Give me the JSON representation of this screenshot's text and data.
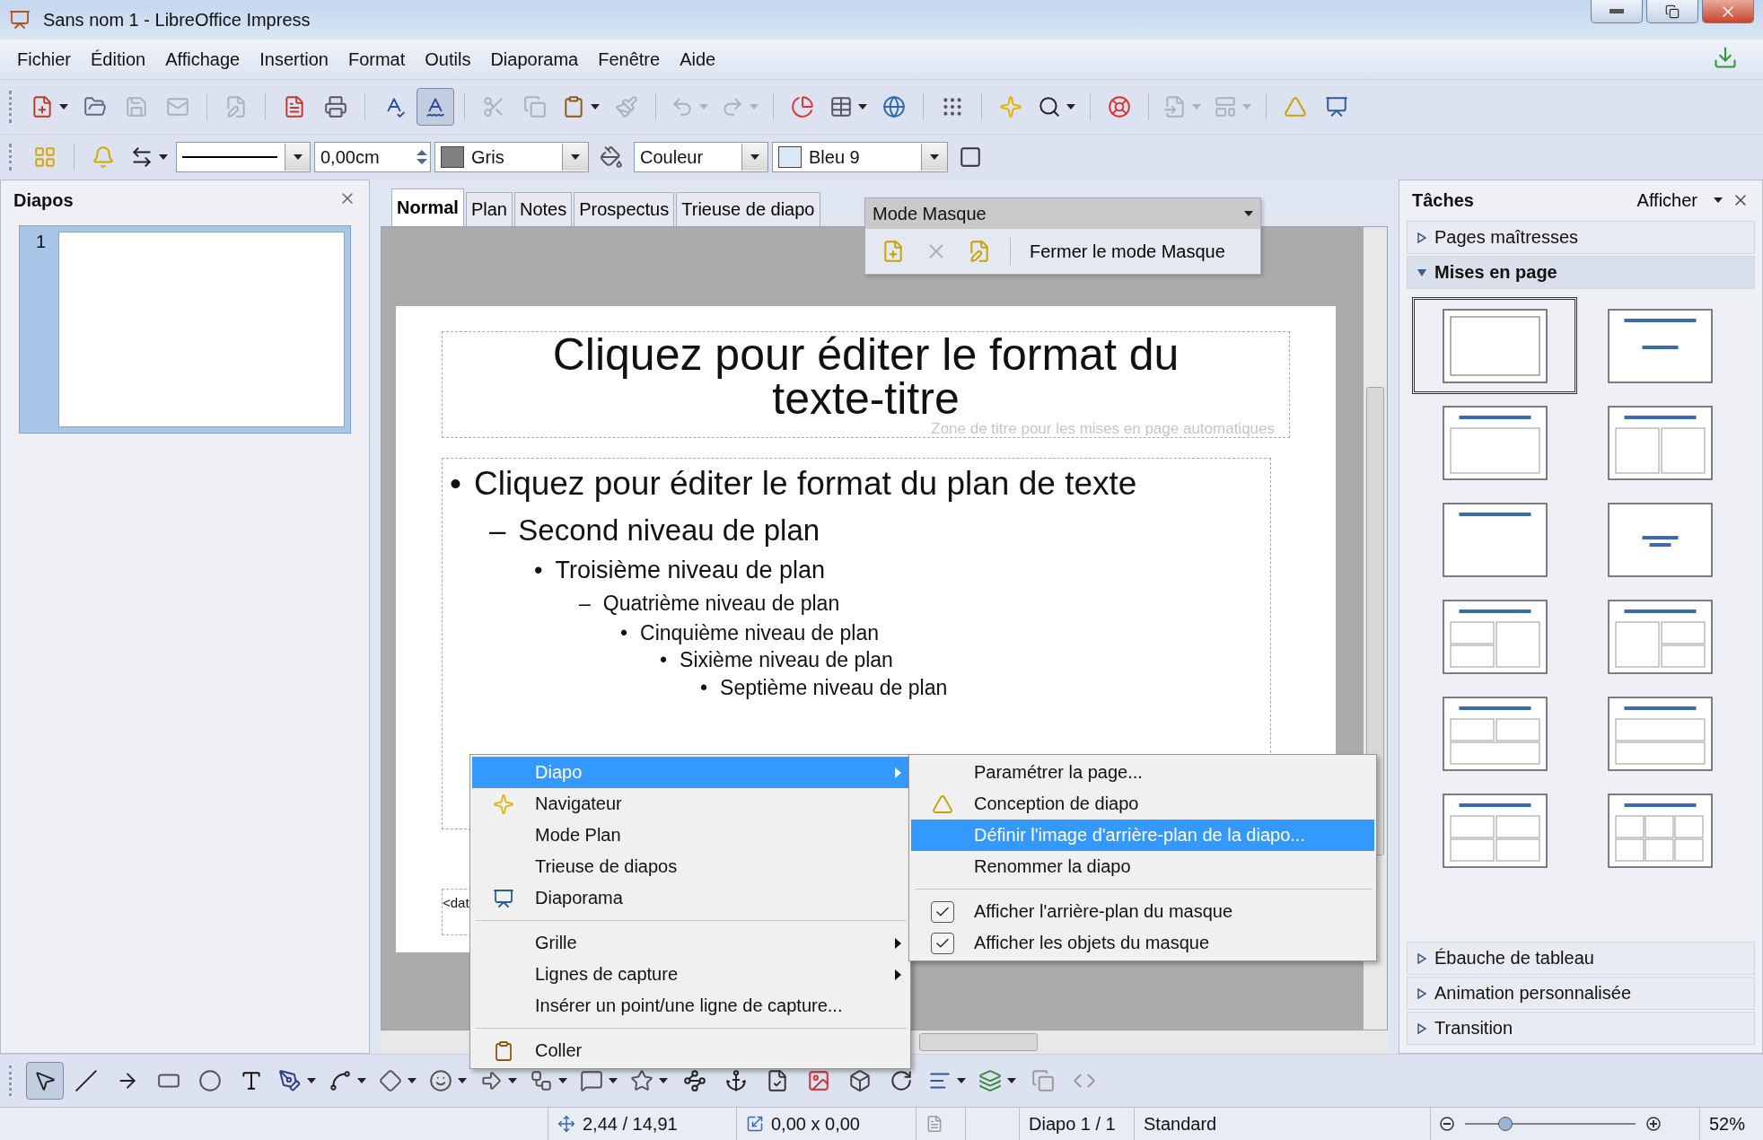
{
  "window": {
    "title": "Sans nom 1 - LibreOffice Impress"
  },
  "menu": [
    "Fichier",
    "Édition",
    "Affichage",
    "Insertion",
    "Format",
    "Outils",
    "Diaporama",
    "Fenêtre",
    "Aide"
  ],
  "toolbar": [
    {
      "disabled": false,
      "pressed": false
    },
    {
      "disabled": false,
      "pressed": false
    },
    {
      "disabled": true,
      "pressed": false
    },
    {
      "disabled": true,
      "pressed": false
    },
    {
      "disabled": true,
      "pressed": false
    },
    {
      "disabled": false,
      "pressed": false
    },
    {
      "disabled": false,
      "pressed": false
    },
    {
      "disabled": false,
      "pressed": false
    },
    {
      "disabled": false,
      "pressed": true
    },
    {
      "disabled": true,
      "pressed": false
    },
    {
      "disabled": true,
      "pressed": false
    },
    {
      "disabled": false,
      "pressed": false
    },
    {
      "disabled": true,
      "pressed": false
    },
    {
      "disabled": true,
      "pressed": false
    },
    {
      "disabled": true,
      "pressed": false
    },
    {
      "disabled": false,
      "pressed": false
    },
    {
      "disabled": false,
      "pressed": false
    },
    {
      "disabled": false,
      "pressed": false
    },
    {
      "disabled": false,
      "pressed": false
    },
    {
      "disabled": false,
      "pressed": false
    },
    {
      "disabled": false,
      "pressed": false
    },
    {
      "disabled": false,
      "pressed": false
    },
    {
      "disabled": true,
      "pressed": false
    },
    {
      "disabled": true,
      "pressed": false
    },
    {
      "disabled": false,
      "pressed": false
    },
    {
      "disabled": false,
      "pressed": false
    }
  ],
  "line_toolbar": {
    "line_width": "0,00cm",
    "line_color": {
      "label": "Gris",
      "color": "#7f7f7f"
    },
    "area_style": "Couleur",
    "area_color": {
      "label": "Bleu 9",
      "color": "#dce9f5"
    }
  },
  "slides_panel": {
    "title": "Diapos",
    "slides": [
      {
        "number": "1",
        "selected": true
      }
    ]
  },
  "tabs": [
    {
      "label": "Normal",
      "selected": true
    },
    {
      "label": "Plan",
      "selected": false
    },
    {
      "label": "Notes",
      "selected": false
    },
    {
      "label": "Prospectus",
      "selected": false
    },
    {
      "label": "Trieuse de diapo",
      "selected": false
    }
  ],
  "master_toolbar": {
    "title": "Mode Masque",
    "close_button": "Fermer le mode Masque"
  },
  "slide": {
    "title": "Cliquez pour éditer le format du texte-titre",
    "title_hint": "Zone de titre pour les mises en page automatiques",
    "footer": "<dat",
    "outline": [
      {
        "marker": "•",
        "text": "Cliquez pour éditer le format du plan de texte",
        "children": [
          {
            "marker": "–",
            "text": "Second niveau de plan",
            "children": [
              {
                "marker": "•",
                "text": "Troisième niveau de plan",
                "children": [
                  {
                    "marker": "–",
                    "text": "Quatrième niveau de plan",
                    "children": [
                      {
                        "marker": "•",
                        "text": "Cinquième niveau de plan",
                        "children": [
                          {
                            "marker": "•",
                            "text": "Sixième niveau de plan",
                            "children": [
                              {
                                "marker": "•",
                                "text": "Septième niveau de plan"
                              }
                            ]
                          }
                        ]
                      }
                    ]
                  }
                ]
              }
            ]
          }
        ]
      }
    ]
  },
  "tasks": {
    "title": "Tâches",
    "view_menu": "Afficher",
    "sections_top": [
      {
        "label": "Pages maîtresses",
        "expanded": false
      },
      {
        "label": "Mises en page",
        "expanded": true
      }
    ],
    "layouts": [
      {
        "kind": "blank",
        "selected": true
      },
      {
        "kind": "title-subtitle",
        "selected": false
      },
      {
        "kind": "title-content",
        "selected": false
      },
      {
        "kind": "title-two-columns",
        "selected": false
      },
      {
        "kind": "title-only",
        "selected": false
      },
      {
        "kind": "centered-text",
        "selected": false
      },
      {
        "kind": "title-two-left",
        "selected": false
      },
      {
        "kind": "title-two-right",
        "selected": false
      },
      {
        "kind": "title-two-top",
        "selected": false
      },
      {
        "kind": "title-two-rows",
        "selected": false
      },
      {
        "kind": "title-four",
        "selected": false
      },
      {
        "kind": "title-six",
        "selected": false
      }
    ],
    "sections_bottom": [
      {
        "label": "Ébauche de tableau",
        "expanded": false
      },
      {
        "label": "Animation personnalisée",
        "expanded": false
      },
      {
        "label": "Transition",
        "expanded": false
      }
    ]
  },
  "draw_toolbar": [
    {
      "selected": true
    },
    {
      "selected": false
    },
    {
      "selected": false
    },
    {
      "selected": false
    },
    {
      "selected": false
    },
    {
      "selected": false
    },
    {
      "selected": false
    },
    {
      "selected": false
    },
    {
      "selected": false
    },
    {
      "selected": false
    },
    {
      "selected": false
    },
    {
      "selected": false
    },
    {
      "selected": false
    },
    {
      "selected": false
    },
    {
      "selected": false
    },
    {
      "selected": false
    },
    {
      "selected": false
    },
    {
      "selected": false
    },
    {
      "selected": false
    },
    {
      "selected": false
    },
    {
      "selected": false
    },
    {
      "selected": false
    },
    {
      "selected": false
    },
    {
      "selected": false
    }
  ],
  "context_menu": [
    {
      "kind": "item",
      "label": "Diapo",
      "selected": true,
      "submenu": true
    },
    {
      "kind": "item",
      "label": "Navigateur",
      "selected": false,
      "submenu": false
    },
    {
      "kind": "item",
      "label": "Mode Plan",
      "selected": false,
      "submenu": false
    },
    {
      "kind": "item",
      "label": "Trieuse de diapos",
      "selected": false,
      "submenu": false
    },
    {
      "kind": "item",
      "label": "Diaporama",
      "selected": false,
      "submenu": false
    },
    {
      "kind": "separator"
    },
    {
      "kind": "item",
      "label": "Grille",
      "selected": false,
      "submenu": true
    },
    {
      "kind": "item",
      "label": "Lignes de capture",
      "selected": false,
      "submenu": true
    },
    {
      "kind": "item",
      "label": "Insérer un point/une ligne de capture...",
      "selected": false,
      "submenu": false
    },
    {
      "kind": "separator"
    },
    {
      "kind": "item",
      "label": "Coller",
      "selected": false,
      "submenu": false
    }
  ],
  "submenu": [
    {
      "kind": "item",
      "label": "Paramétrer la page...",
      "selected": false
    },
    {
      "kind": "item",
      "label": "Conception de diapo",
      "selected": false
    },
    {
      "kind": "item",
      "label": "Définir l'image d'arrière-plan de la diapo...",
      "selected": true
    },
    {
      "kind": "item",
      "label": "Renommer la diapo",
      "selected": false
    },
    {
      "kind": "separator"
    },
    {
      "kind": "check",
      "label": "Afficher l'arrière-plan du masque",
      "selected": false,
      "checked": true
    },
    {
      "kind": "check",
      "label": "Afficher les objets du masque",
      "selected": false,
      "checked": true
    }
  ],
  "status_bar": {
    "position": "2,44 / 14,91",
    "size": "0,00 x 0,00",
    "slide": "Diapo 1 / 1",
    "master": "Standard",
    "zoom": {
      "level": 0.23,
      "reading": "52%"
    }
  }
}
